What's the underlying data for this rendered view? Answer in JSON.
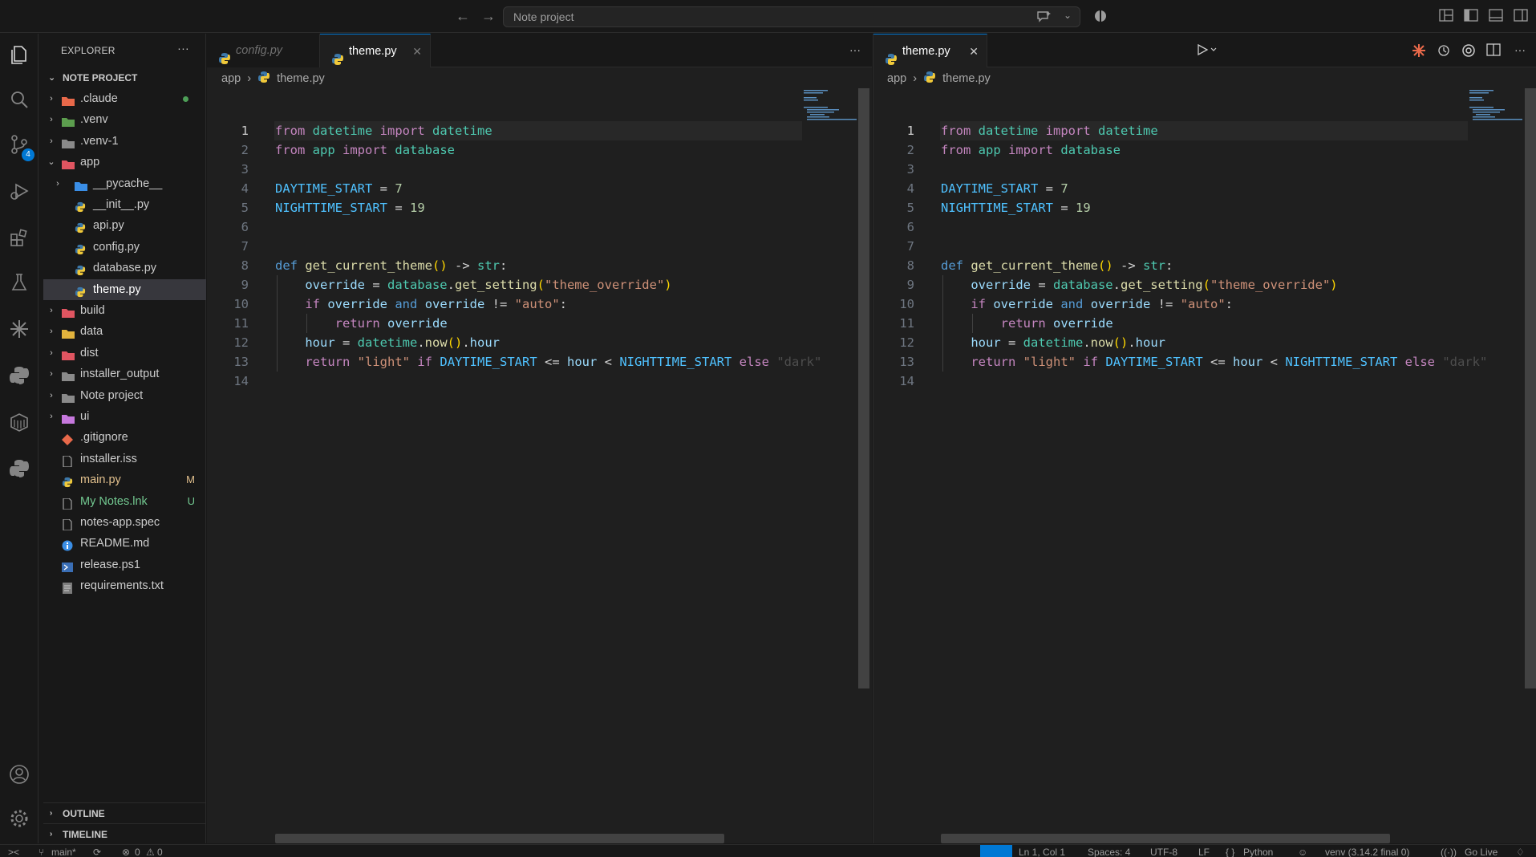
{
  "titlebar": {
    "search_label": "Note project"
  },
  "activity": {
    "scm_badge": "4"
  },
  "sidebar": {
    "header": "EXPLORER",
    "more": "···",
    "project": "NOTE PROJECT",
    "items": [
      {
        "label": ".claude",
        "type": "folder",
        "color": "#e8694a",
        "status": "dot"
      },
      {
        "label": ".venv",
        "type": "folder",
        "color": "#5c9e4e"
      },
      {
        "label": ".venv-1",
        "type": "folder",
        "color": "#8a8a8a"
      },
      {
        "label": "app",
        "type": "folder-open",
        "color": "#e05561"
      },
      {
        "label": "__pycache__",
        "type": "folder",
        "color": "#3a8ee6"
      },
      {
        "label": "__init__.py",
        "type": "python"
      },
      {
        "label": "api.py",
        "type": "python"
      },
      {
        "label": "config.py",
        "type": "python"
      },
      {
        "label": "database.py",
        "type": "python"
      },
      {
        "label": "theme.py",
        "type": "python",
        "selected": true
      },
      {
        "label": "build",
        "type": "folder",
        "color": "#e05561"
      },
      {
        "label": "data",
        "type": "folder",
        "color": "#e2b33d"
      },
      {
        "label": "dist",
        "type": "folder",
        "color": "#e05561"
      },
      {
        "label": "installer_output",
        "type": "folder",
        "color": "#8a8a8a"
      },
      {
        "label": "Note project",
        "type": "folder",
        "color": "#8a8a8a"
      },
      {
        "label": "ui",
        "type": "folder",
        "color": "#c678dd"
      },
      {
        "label": ".gitignore",
        "type": "git"
      },
      {
        "label": "installer.iss",
        "type": "file"
      },
      {
        "label": "main.py",
        "type": "python",
        "status": "M",
        "status_color": "#e2c08d",
        "label_color": "#e2c08d"
      },
      {
        "label": "My Notes.lnk",
        "type": "file",
        "status": "U",
        "status_color": "#73c991",
        "label_color": "#73c991"
      },
      {
        "label": "notes-app.spec",
        "type": "file"
      },
      {
        "label": "README.md",
        "type": "info"
      },
      {
        "label": "release.ps1",
        "type": "ps"
      },
      {
        "label": "requirements.txt",
        "type": "txt"
      }
    ],
    "outline": "OUTLINE",
    "timeline": "TIMELINE"
  },
  "left_editor": {
    "tabs": [
      {
        "name": "config.py",
        "active": false
      },
      {
        "name": "theme.py",
        "active": true
      }
    ],
    "more": "···",
    "breadcrumb": {
      "folder": "app",
      "file": "theme.py"
    }
  },
  "right_editor": {
    "tabs": [
      {
        "name": "theme.py",
        "active": true
      }
    ],
    "more": "···",
    "breadcrumb": {
      "folder": "app",
      "file": "theme.py"
    }
  },
  "code": {
    "line_numbers": [
      "1",
      "2",
      "3",
      "4",
      "5",
      "6",
      "7",
      "8",
      "9",
      "10",
      "11",
      "12",
      "13",
      "14"
    ],
    "lines": [
      [
        [
          "kw2",
          "from"
        ],
        [
          "plain",
          " "
        ],
        [
          "mod",
          "datetime"
        ],
        [
          "plain",
          " "
        ],
        [
          "kw2",
          "import"
        ],
        [
          "plain",
          " "
        ],
        [
          "mod",
          "datetime"
        ]
      ],
      [
        [
          "kw2",
          "from"
        ],
        [
          "plain",
          " "
        ],
        [
          "mod",
          "app"
        ],
        [
          "plain",
          " "
        ],
        [
          "kw2",
          "import"
        ],
        [
          "plain",
          " "
        ],
        [
          "mod",
          "database"
        ]
      ],
      [],
      [
        [
          "const",
          "DAYTIME_START"
        ],
        [
          "plain",
          " = "
        ],
        [
          "num",
          "7"
        ]
      ],
      [
        [
          "const",
          "NIGHTTIME_START"
        ],
        [
          "plain",
          " = "
        ],
        [
          "num",
          "19"
        ]
      ],
      [],
      [],
      [
        [
          "kw",
          "def"
        ],
        [
          "plain",
          " "
        ],
        [
          "fn",
          "get_current_theme"
        ],
        [
          "paren",
          "()"
        ],
        [
          "plain",
          " -> "
        ],
        [
          "mod",
          "str"
        ],
        [
          "plain",
          ":"
        ]
      ],
      [
        [
          "plain",
          "    "
        ],
        [
          "var",
          "override"
        ],
        [
          "plain",
          " = "
        ],
        [
          "mod",
          "database"
        ],
        [
          "plain",
          "."
        ],
        [
          "fn",
          "get_setting"
        ],
        [
          "paren",
          "("
        ],
        [
          "str",
          "\"theme_override\""
        ],
        [
          "paren",
          ")"
        ]
      ],
      [
        [
          "plain",
          "    "
        ],
        [
          "kw2",
          "if"
        ],
        [
          "plain",
          " "
        ],
        [
          "var",
          "override"
        ],
        [
          "plain",
          " "
        ],
        [
          "kw",
          "and"
        ],
        [
          "plain",
          " "
        ],
        [
          "var",
          "override"
        ],
        [
          "plain",
          " != "
        ],
        [
          "str",
          "\"auto\""
        ],
        [
          "plain",
          ":"
        ]
      ],
      [
        [
          "plain",
          "        "
        ],
        [
          "kw2",
          "return"
        ],
        [
          "plain",
          " "
        ],
        [
          "var",
          "override"
        ]
      ],
      [
        [
          "plain",
          "    "
        ],
        [
          "var",
          "hour"
        ],
        [
          "plain",
          " = "
        ],
        [
          "mod",
          "datetime"
        ],
        [
          "plain",
          "."
        ],
        [
          "fn",
          "now"
        ],
        [
          "paren",
          "()"
        ],
        [
          "plain",
          "."
        ],
        [
          "var",
          "hour"
        ]
      ],
      [
        [
          "plain",
          "    "
        ],
        [
          "kw2",
          "return"
        ],
        [
          "plain",
          " "
        ],
        [
          "str",
          "\"light\""
        ],
        [
          "plain",
          " "
        ],
        [
          "kw2",
          "if"
        ],
        [
          "plain",
          " "
        ],
        [
          "const",
          "DAYTIME_START"
        ],
        [
          "plain",
          " <= "
        ],
        [
          "var",
          "hour"
        ],
        [
          "plain",
          " < "
        ],
        [
          "const",
          "NIGHTTIME_START"
        ],
        [
          "plain",
          " "
        ],
        [
          "kw2",
          "else"
        ],
        [
          "plain",
          " "
        ],
        [
          "fade",
          "\"dark\""
        ]
      ],
      []
    ]
  },
  "statusbar": {
    "branch": "main*",
    "problems": "0",
    "warnings": "0",
    "position": "Ln 1, Col 1",
    "spaces": "Spaces: 4",
    "encoding": "UTF-8",
    "eol": "LF",
    "language": "Python",
    "interpreter": "venv (3.14.2 final 0)",
    "golive": "Go Live"
  }
}
